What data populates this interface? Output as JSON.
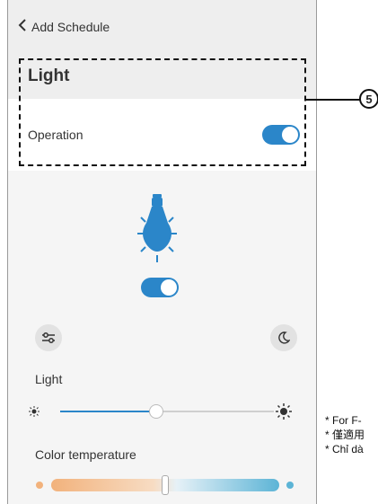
{
  "header": {
    "back_icon": "chevron-left-icon",
    "title": "Add Schedule"
  },
  "device": {
    "name": "Light"
  },
  "operation": {
    "label": "Operation",
    "on": true
  },
  "bulb": {
    "icon": "lightbulb-icon",
    "on": true,
    "color": "#2b86c9"
  },
  "buttons": {
    "left_icon": "sliders-icon",
    "right_icon": "moon-icon"
  },
  "brightness": {
    "label": "Light",
    "value_fraction": 0.45
  },
  "color_temperature": {
    "label": "Color temperature",
    "value_fraction": 0.5
  },
  "callout": {
    "number": "5"
  },
  "notes": [
    "* For F-",
    "* 僅適用",
    "* Chỉ dà"
  ],
  "colors": {
    "accent": "#2b86c9",
    "header_bg": "#eeeeee",
    "content_bg": "#f5f5f5"
  }
}
